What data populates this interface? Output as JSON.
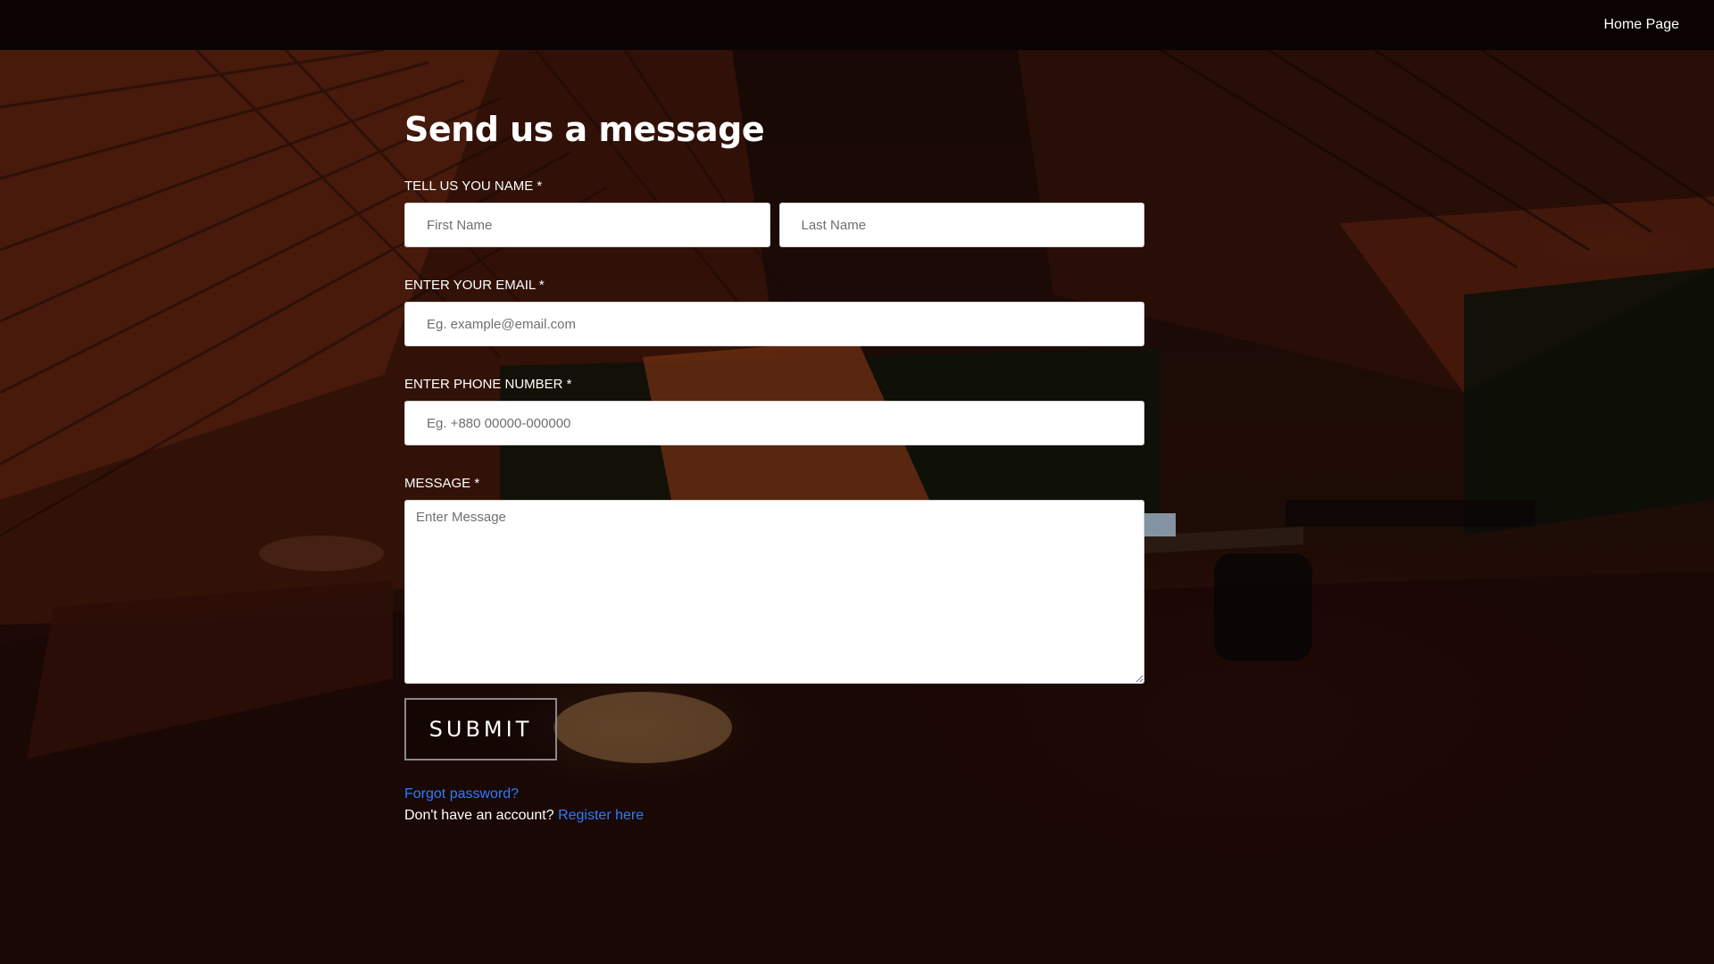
{
  "nav": {
    "home_label": "Home Page"
  },
  "form": {
    "title": "Send us a message",
    "name_label": "TELL US YOU NAME *",
    "first_name_placeholder": "First Name",
    "last_name_placeholder": "Last Name",
    "email_label": "ENTER YOUR EMAIL *",
    "email_placeholder": "Eg. example@email.com",
    "phone_label": "ENTER PHONE NUMBER *",
    "phone_placeholder": "Eg. +880 00000-000000",
    "message_label": "MESSAGE *",
    "message_placeholder": "Enter Message",
    "submit_label": "SUBMIT"
  },
  "footer_links": {
    "forgot_password": "Forgot password?",
    "no_account_text": "Don't have an account?",
    "register_link": "Register here"
  },
  "colors": {
    "link": "#2f7bff",
    "text": "#ffffff",
    "background": "#1d0b06"
  }
}
